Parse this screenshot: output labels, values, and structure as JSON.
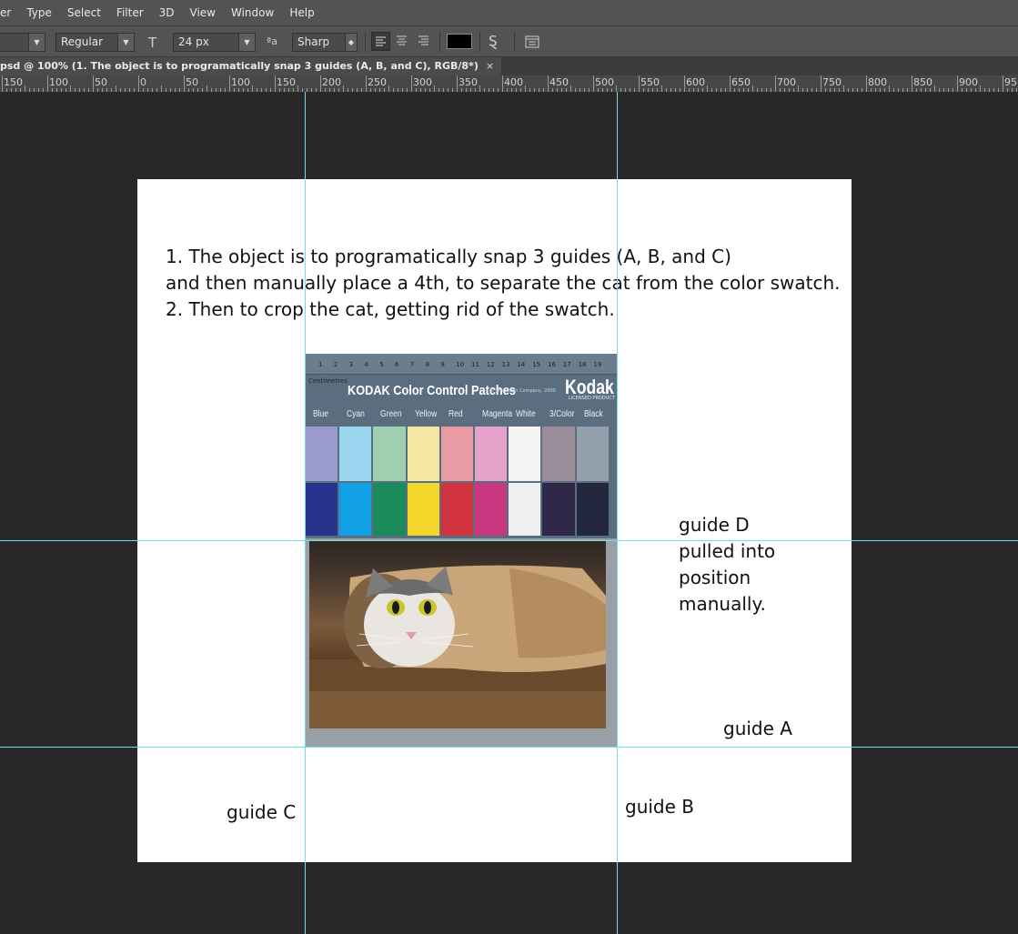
{
  "menu": {
    "items": [
      "er",
      "Type",
      "Select",
      "Filter",
      "3D",
      "View",
      "Window",
      "Help"
    ]
  },
  "options": {
    "font_style": "Regular",
    "font_size": "24 px",
    "antialias_icon_text": "a",
    "antialias": "Sharp",
    "text_color": "#000000"
  },
  "document": {
    "tab_title": "psd @ 100% (1. The object is to programatically snap 3 guides (A, B, and C), RGB/8*)",
    "close": "×"
  },
  "ruler": {
    "labels": [
      "150",
      "100",
      "50",
      "0",
      "50",
      "100",
      "150",
      "200",
      "250",
      "300",
      "350",
      "400",
      "450",
      "500",
      "550",
      "600",
      "650",
      "700",
      "750",
      "800",
      "850",
      "900",
      "95"
    ]
  },
  "canvas": {
    "instructions": [
      "1. The object is to programatically snap 3 guides (A, B, and C)",
      "and then manually place a  4th, to separate the cat from the color swatch.",
      "2. Then to crop the cat, getting rid of the swatch."
    ],
    "guide_d_lines": [
      "guide D",
      "pulled into",
      "position",
      "manually."
    ],
    "guide_a": "guide A",
    "guide_b": "guide B",
    "guide_c": "guide C"
  },
  "swatch": {
    "title": "KODAK Color Control Patches",
    "brand": "Kodak",
    "centimetres": "Centimetres",
    "small_print": "© The Tiffen Company, 2000",
    "brand_sub": "LICENSED PRODUCT",
    "ruler_numbers": [
      "1",
      "2",
      "3",
      "4",
      "5",
      "6",
      "7",
      "8",
      "9",
      "10",
      "11",
      "12",
      "13",
      "14",
      "15",
      "16",
      "17",
      "18",
      "19"
    ],
    "color_names": [
      "Blue",
      "Cyan",
      "Green",
      "Yellow",
      "Red",
      "Magenta",
      "White",
      "3/Color",
      "Black"
    ],
    "light_colors": [
      "#9b9bd0",
      "#9ad6f0",
      "#9ecfb0",
      "#f3e7a3",
      "#e89ba2",
      "#e5a2cb",
      "#f4f4f4",
      "#9a8c98",
      "#93a0ab"
    ],
    "dark_colors": [
      "#27338d",
      "#119fe6",
      "#1b8a5b",
      "#f2d62a",
      "#d2343f",
      "#c8377f",
      "#f0f0f0",
      "#2f2848",
      "#23273e"
    ]
  },
  "colors": {
    "guide": "#6ee1ea",
    "canvas_bg": "#ffffff",
    "workspace": "#282828"
  }
}
